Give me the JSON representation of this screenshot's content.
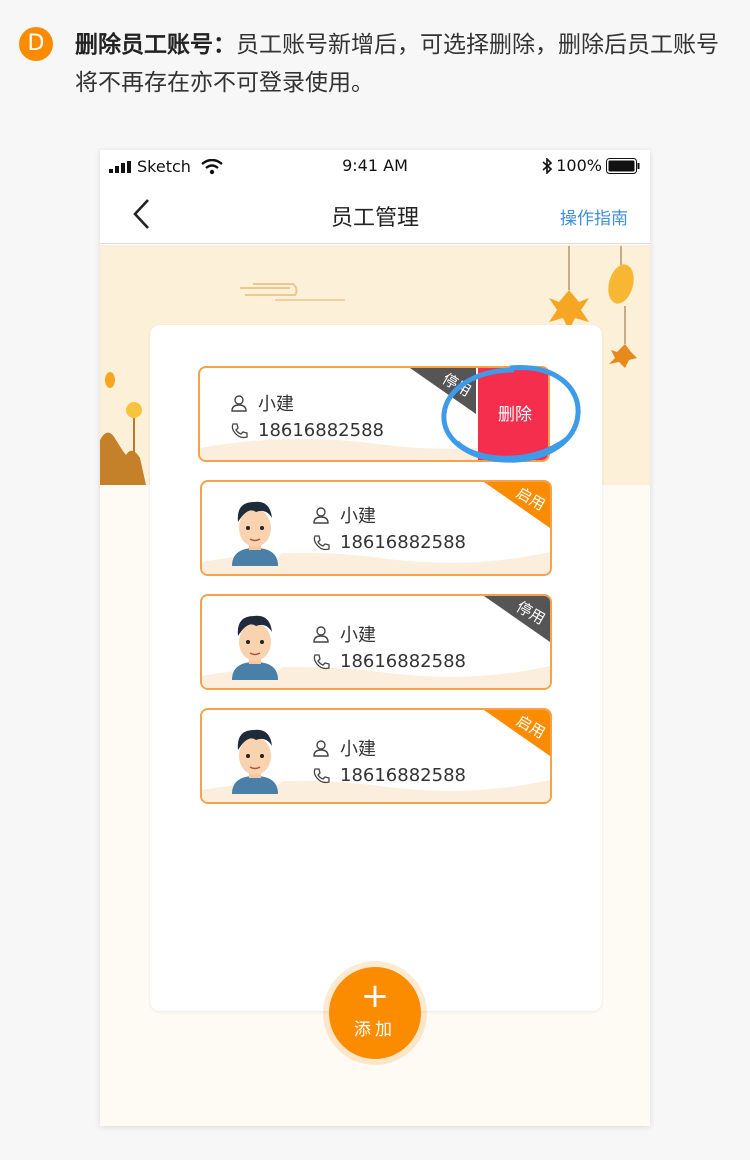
{
  "header": {
    "step": "D",
    "title": "删除员工账号",
    "colon": "：",
    "text": "员工账号新增后，可选择删除，删除后员工账号将不再存在亦不可登录使用。"
  },
  "statusbar": {
    "carrier": "Sketch",
    "time": "9:41 AM",
    "battery": "100%"
  },
  "nav": {
    "title": "员工管理",
    "guide": "操作指南"
  },
  "employees": [
    {
      "name": "小建",
      "phone": "18616882588",
      "status": "停用",
      "swiped": true
    },
    {
      "name": "小建",
      "phone": "18616882588",
      "status": "启用",
      "swiped": false
    },
    {
      "name": "小建",
      "phone": "18616882588",
      "status": "停用",
      "swiped": false
    },
    {
      "name": "小建",
      "phone": "18616882588",
      "status": "启用",
      "swiped": false
    }
  ],
  "delete_label": "删除",
  "add": {
    "plus": "+",
    "label": "添加"
  },
  "colors": {
    "accent": "#fb8c00",
    "delete": "#f42e4c",
    "guide": "#3d8fe0",
    "disabled_tag": "#555555",
    "enabled_tag": "#fb8c00"
  }
}
